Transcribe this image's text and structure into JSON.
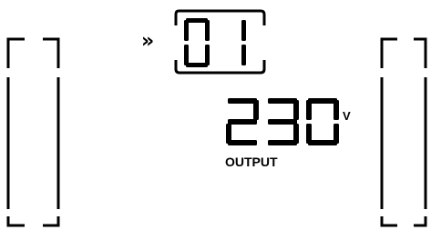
{
  "display": {
    "mode_indicator": "»",
    "program_number": "01",
    "reading": {
      "value": "230",
      "unit": "V",
      "label": "OUTPUT"
    },
    "colors": {
      "foreground": "#000000",
      "background": "#ffffff"
    },
    "icons": {
      "mode_indicator": "double-chevron-right-icon",
      "left_gauge": "left-bar-gauge-icon",
      "right_gauge": "right-bar-gauge-icon"
    }
  }
}
